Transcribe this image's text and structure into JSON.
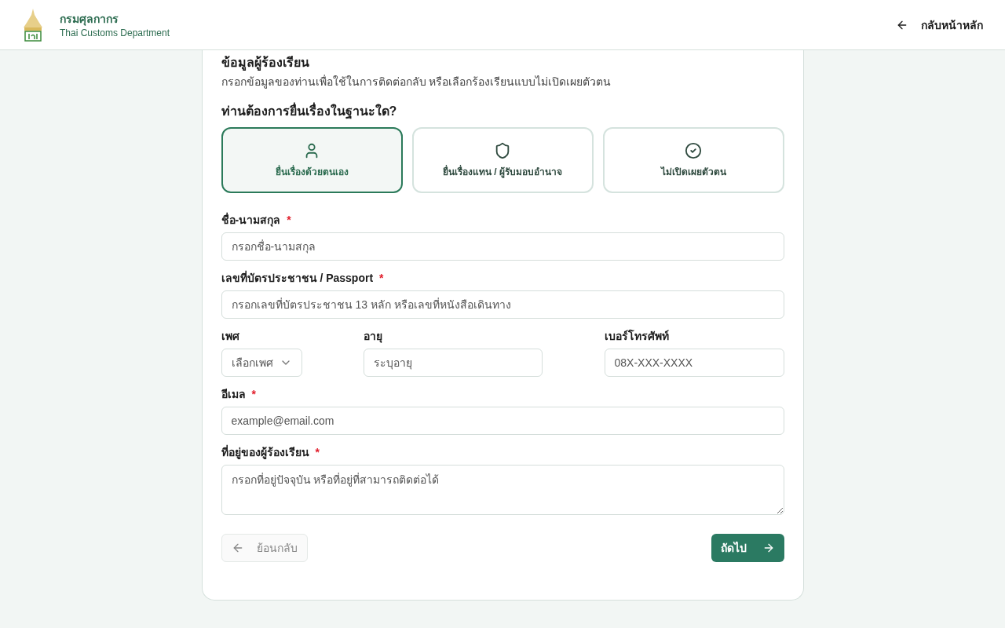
{
  "header": {
    "org_name": "กรมศุลกากร",
    "org_subtitle": "Thai Customs Department",
    "back_home": "กลับหน้าหลัก"
  },
  "section": {
    "title": "ข้อมูลผู้ร้องเรียน",
    "description": "กรอกข้อมูลของท่านเพื่อใช้ในการติดต่อกลับ หรือเลือกร้องเรียนแบบไม่เปิดเผยตัวตน"
  },
  "role_question": "ท่านต้องการยื่นเรื่องในฐานะใด?",
  "roles": [
    {
      "kind": "person",
      "label": "ยื่นเรื่องด้วยตนเอง",
      "selected": true
    },
    {
      "kind": "shield",
      "label": "ยื่นเรื่องแทน / ผู้รับมอบอำนาจ",
      "selected": false
    },
    {
      "kind": "check",
      "label": "ไม่เปิดเผยตัวตน",
      "selected": false
    }
  ],
  "fields": [
    {
      "kind": "input",
      "label": "ชื่อ-นามสกุล",
      "required": true,
      "placeholder": "กรอกชื่อ-นามสกุล"
    },
    {
      "kind": "input",
      "label": "เลขที่บัตรประชาชน / Passport",
      "required": true,
      "placeholder": "กรอกเลขที่บัตรประชาชน 13 หลัก หรือเลขที่หนังสือเดินทาง"
    },
    {
      "kind": "row",
      "items": [
        {
          "kind": "select",
          "label": "เพศ",
          "required": false,
          "placeholder": "เลือกเพศ"
        },
        {
          "kind": "input",
          "label": "อายุ",
          "required": false,
          "placeholder": "ระบุอายุ"
        },
        {
          "kind": "input",
          "label": "เบอร์โทรศัพท์",
          "required": false,
          "placeholder": "08X-XXX-XXXX"
        }
      ]
    },
    {
      "kind": "input",
      "label": "อีเมล",
      "required": true,
      "placeholder": "example@email.com"
    },
    {
      "kind": "textarea",
      "label": "ที่อยู่ของผู้ร้องเรียน",
      "required": true,
      "placeholder": "กรอกที่อยู่ปัจจุบัน หรือที่อยู่ที่สามารถติดต่อได้"
    }
  ],
  "required_mark": "*",
  "buttons": {
    "back": {
      "label": "ย้อนกลับ",
      "disabled": true
    },
    "next": {
      "label": "ถัดไป",
      "disabled": false
    }
  }
}
